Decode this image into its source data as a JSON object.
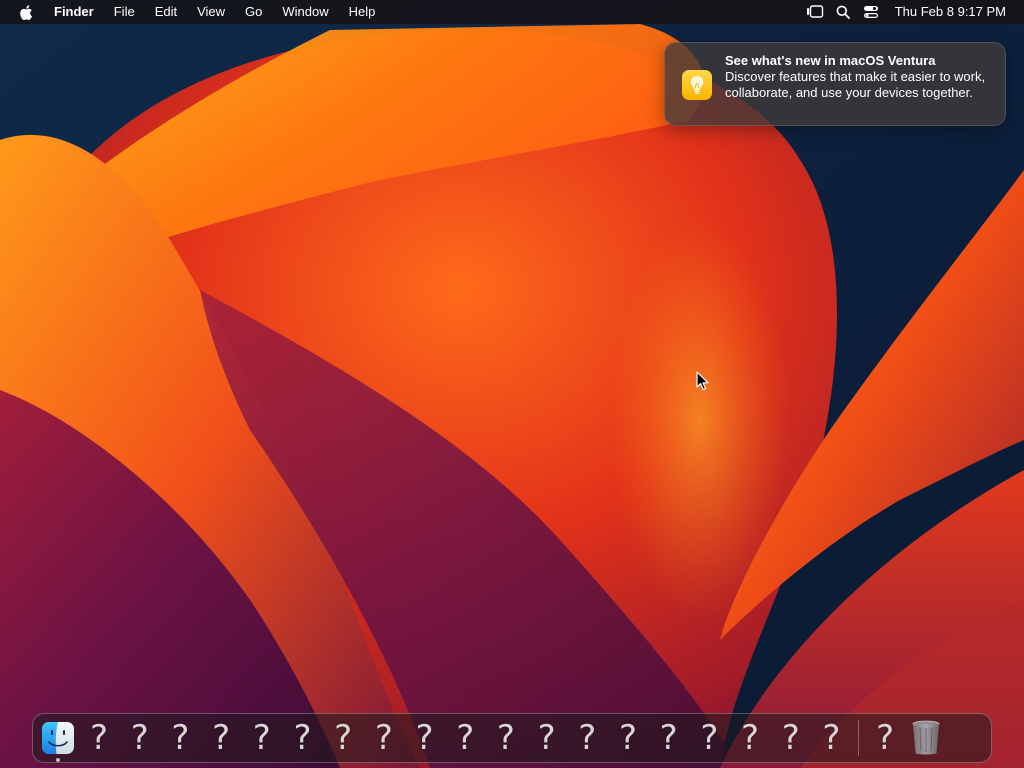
{
  "menubar": {
    "apple_icon": "apple-logo-icon",
    "app_name": "Finder",
    "menus": [
      "File",
      "Edit",
      "View",
      "Go",
      "Window",
      "Help"
    ],
    "status_icons": [
      "stage-manager-icon",
      "spotlight-search-icon",
      "control-center-icon"
    ],
    "clock": "Thu Feb 8  9:17 PM"
  },
  "notification": {
    "icon": "tips-lightbulb-icon",
    "title": "See what's new in macOS Ventura",
    "body": "Discover features that make it easier to work, collaborate, and use your devices together."
  },
  "dock": {
    "finder_icon": "finder-icon",
    "unknown_glyph": "?",
    "unknown_app_count": 20,
    "trash_icon": "trash-icon"
  },
  "colors": {
    "menubar_bg": "#161214",
    "tips_icon": "#f6b400",
    "wallpaper_orange": "#ff7a00",
    "wallpaper_purple": "#5a1040",
    "wallpaper_navy": "#0c1f3a"
  }
}
